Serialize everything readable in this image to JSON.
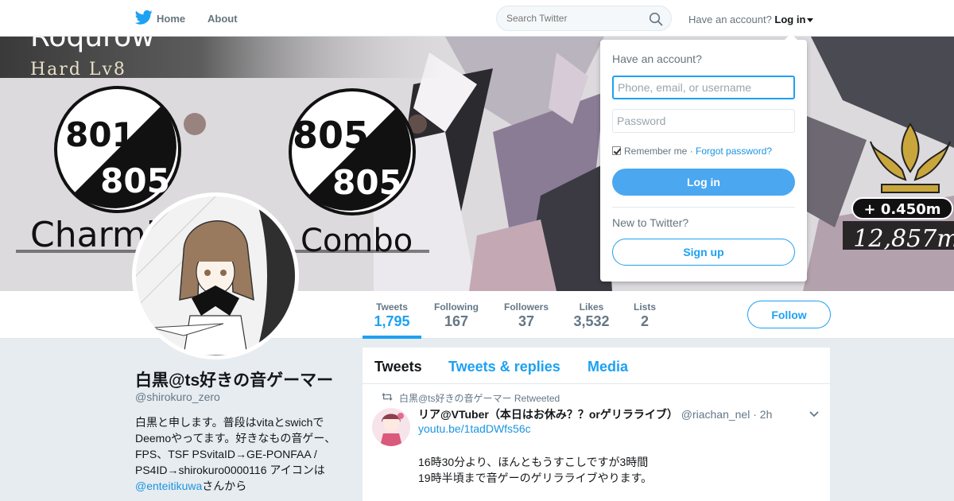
{
  "nav": {
    "home_label": "Home",
    "about_label": "About",
    "search_placeholder": "Search Twitter",
    "have_account": "Have an account?",
    "login_label": "Log in"
  },
  "banner": {
    "top_text": "Roqurow",
    "difficulty": "Hard Lv8",
    "score1_top": "801",
    "score1_bottom": "805",
    "score2_top": "805",
    "score2_bottom": "805",
    "label_charming": "Charmin",
    "label_combo": "Combo",
    "distance_delta": "+ 0.450m",
    "distance_total": "12,857m"
  },
  "stats": [
    {
      "label": "Tweets",
      "value": "1,795"
    },
    {
      "label": "Following",
      "value": "167"
    },
    {
      "label": "Followers",
      "value": "37"
    },
    {
      "label": "Likes",
      "value": "3,532"
    },
    {
      "label": "Lists",
      "value": "2"
    }
  ],
  "follow_label": "Follow",
  "profile": {
    "name": "白黒@ts好きの音ゲーマー",
    "handle": "@shirokuro_zero",
    "bio_lines": [
      "白黒と申します。普段はvitaとswichで",
      "Deemoやってます。好きなもの音ゲー、",
      "FPS、TSF PSvitaID→GE-PONFAA /",
      "PS4ID→shirokuro0000116 アイコンは"
    ],
    "bio_mention": "@enteitikuwa",
    "bio_tail": "さんから"
  },
  "timeline": {
    "tabs": [
      "Tweets",
      "Tweets & replies",
      "Media"
    ],
    "tweet": {
      "retweeted_by": "白黒@ts好きの音ゲーマー Retweeted",
      "fullname": "リア@VTuber（本日はお休み？？orゲリラライブ）",
      "username": "@riachan_nel",
      "time": "2h",
      "link": "youtu.be/1tadDWfs56c",
      "line1": "16時30分より、ほんともうすこしですが3時間",
      "line2": "19時半頃まで音ゲーのゲリラライブやります。"
    }
  },
  "login_dropdown": {
    "title": "Have an account?",
    "username_placeholder": "Phone, email, or username",
    "password_placeholder": "Password",
    "remember_label": "Remember me",
    "separator": " · ",
    "forgot_label": "Forgot password?",
    "login_button": "Log in",
    "new_label": "New to Twitter?",
    "signup_button": "Sign up"
  },
  "colors": {
    "accent": "#1da1f2",
    "link": "#1b95e0",
    "muted": "#657786",
    "page_bg": "#e6ecf0"
  }
}
